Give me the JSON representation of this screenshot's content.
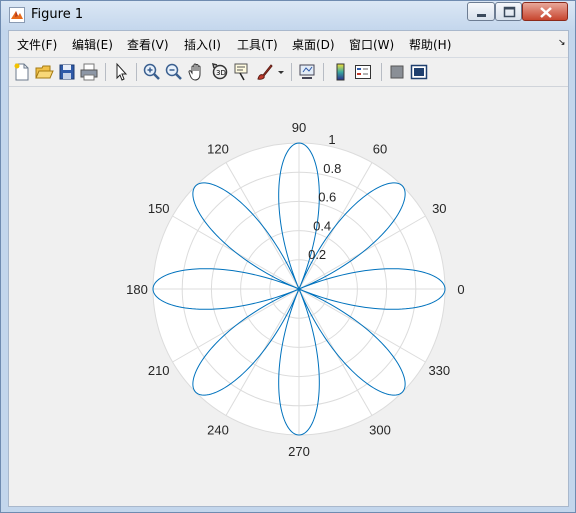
{
  "window": {
    "title": "Figure 1"
  },
  "menu": [
    {
      "label": "文件(F)"
    },
    {
      "label": "编辑(E)"
    },
    {
      "label": "查看(V)"
    },
    {
      "label": "插入(I)"
    },
    {
      "label": "工具(T)"
    },
    {
      "label": "桌面(D)"
    },
    {
      "label": "窗口(W)"
    },
    {
      "label": "帮助(H)"
    }
  ],
  "toolbar": {
    "buttons": [
      "new-figure-icon",
      "open-file-icon",
      "save-icon",
      "print-icon",
      "pointer-icon",
      "zoom-in-icon",
      "zoom-out-icon",
      "pan-hand-icon",
      "rotate-3d-icon",
      "data-cursor-icon",
      "brush-icon",
      "brush-dropdown-icon",
      "link-plot-icon",
      "colorbar-icon",
      "legend-icon",
      "hide-plot-tools-icon",
      "show-plot-tools-icon"
    ]
  },
  "colors": {
    "curve": "#0072BD",
    "axes_bg": "#ffffff",
    "grid": "#dcdcdc",
    "figure_bg": "#f0f0f0"
  },
  "chart_data": {
    "type": "polar",
    "equation_samples": "r = |cos(4θ)|",
    "theta_ticks": [
      "0",
      "30",
      "60",
      "90",
      "120",
      "150",
      "180",
      "210",
      "240",
      "270",
      "300",
      "330"
    ],
    "r_ticks": [
      "0.2",
      "0.4",
      "0.6",
      "0.8",
      "1"
    ],
    "rlim": [
      0,
      1
    ],
    "grid": true,
    "series": [
      {
        "petals": 8,
        "petal_angles_deg": [
          0,
          45,
          90,
          135,
          180,
          225,
          270,
          315
        ],
        "r_max": 1
      }
    ]
  }
}
